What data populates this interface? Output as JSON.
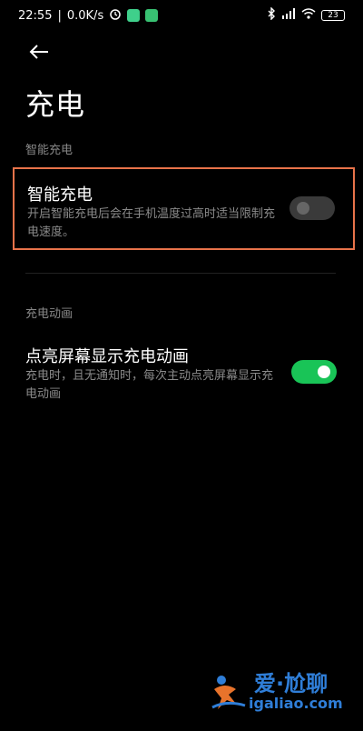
{
  "status_bar": {
    "time": "22:55",
    "speed": "0.0K/s",
    "battery": "23",
    "left_icons": [
      "alarm-icon",
      "app-icon",
      "app-icon"
    ],
    "right_icons": [
      "bluetooth-icon",
      "signal-icon",
      "wifi-icon",
      "battery-icon"
    ]
  },
  "header": {
    "back_icon": "back-arrow-icon",
    "title": "充电"
  },
  "sections": [
    {
      "label": "智能充电",
      "setting": {
        "title": "智能充电",
        "description": "开启智能充电后会在手机温度过高时适当限制充电速度。",
        "toggle_on": false
      }
    },
    {
      "label": "充电动画",
      "setting": {
        "title": "点亮屏幕显示充电动画",
        "description": "充电时，且无通知时，每次主动点亮屏幕显示充电动画",
        "toggle_on": true
      }
    }
  ],
  "watermark": {
    "top": "爱·尬聊",
    "bottom": "igaliao.com"
  },
  "colors": {
    "highlight_border": "#e8734a",
    "toggle_on": "#19c457",
    "toggle_off": "#3a3a3a"
  }
}
